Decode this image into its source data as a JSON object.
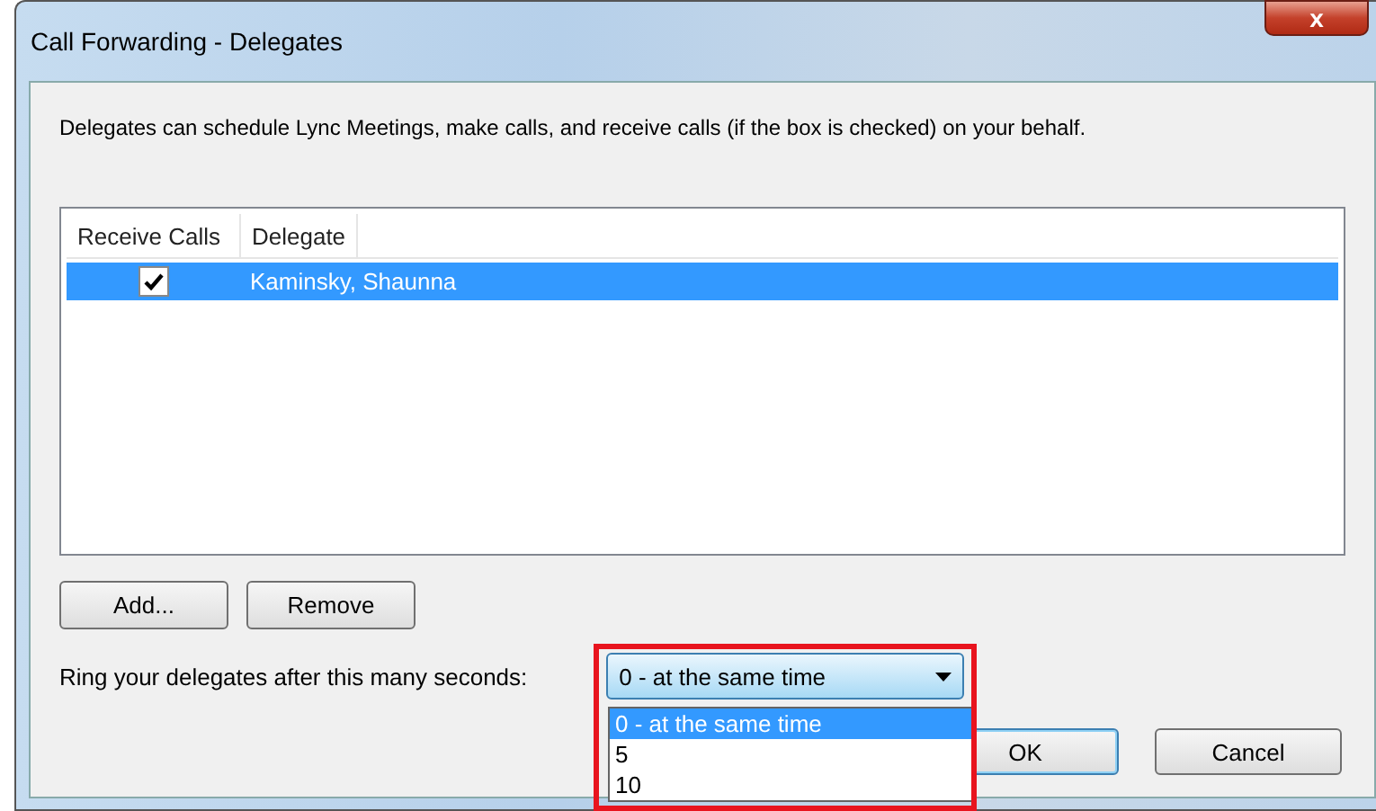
{
  "window": {
    "title": "Call Forwarding - Delegates",
    "close": "x"
  },
  "description": "Delegates can schedule Lync Meetings, make calls, and receive calls (if the box is checked) on your behalf.",
  "table": {
    "columns": [
      "Receive Calls",
      "Delegate"
    ],
    "rows": [
      {
        "receive_calls": true,
        "delegate": "Kaminsky, Shaunna",
        "selected": true
      }
    ]
  },
  "buttons": [
    "Add...",
    "Remove"
  ],
  "ring": {
    "label": "Ring your delegates after this many seconds:",
    "value": "0 - at the same time",
    "expanded": true,
    "highlighted": true,
    "options": [
      {
        "label": "0 - at the same time",
        "selected": true
      },
      {
        "label": "5",
        "selected": false
      },
      {
        "label": "10",
        "selected": false
      }
    ]
  },
  "footer_buttons": [
    {
      "label": "OK",
      "default": true
    },
    {
      "label": "Cancel",
      "default": false
    }
  ]
}
